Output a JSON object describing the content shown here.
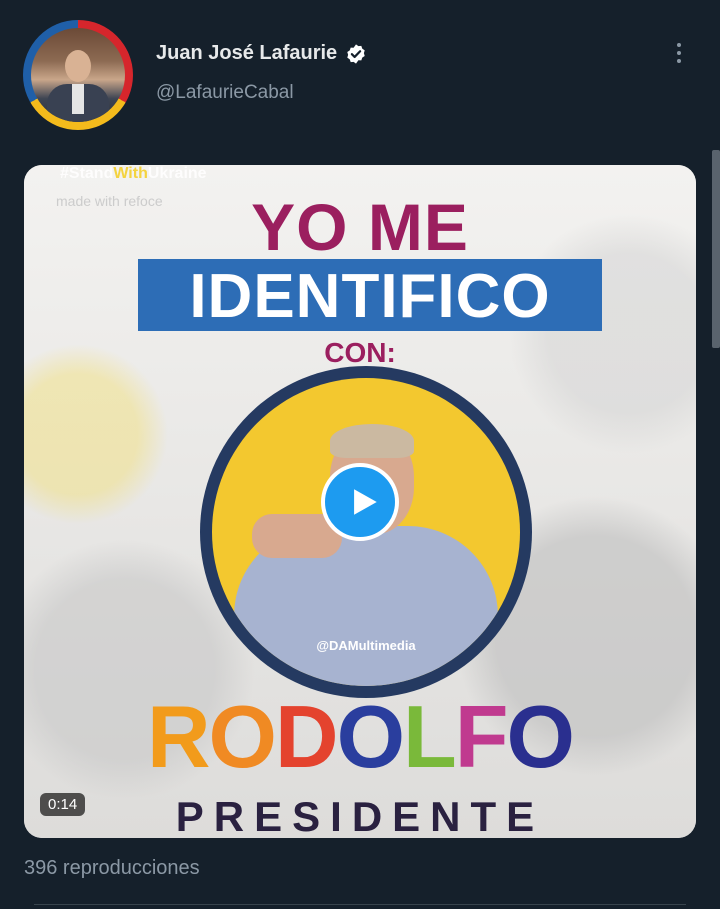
{
  "author": {
    "name": "Juan José Lafaurie",
    "handle": "@LafaurieCabal",
    "verified_icon": "verified-badge-icon",
    "avatar_ring_colors": [
      "#d6262c",
      "#f4bb1c",
      "#1f5fa8"
    ]
  },
  "menu": {
    "icon": "more-options-icon"
  },
  "media": {
    "overlay_hashtag_prefix": "#Stand",
    "overlay_hashtag_highlight": "With",
    "overlay_hashtag_suffix": "Ukraine",
    "overlay_watermark": "made with  refoce",
    "headline_1": "YO ME",
    "headline_2": "IDENTIFICO",
    "headline_3": "CON:",
    "photo_credit": "@DAMultimedia",
    "name_letters": [
      "R",
      "O",
      "D",
      "O",
      "L",
      "F",
      "O"
    ],
    "subtitle": "PRESIDENTE",
    "duration": "0:14",
    "play_icon": "play-icon",
    "colors": {
      "magenta": "#9b1f5f",
      "blue_band": "#2d6db6",
      "yellow_circle": "#f3c82f",
      "navy_ring": "#253a61"
    }
  },
  "stats": {
    "views": "396 reproducciones"
  },
  "theme": {
    "background": "#15202b",
    "text": "#e7e9ea",
    "muted": "#8b98a5",
    "accent": "#1d9bf0"
  }
}
